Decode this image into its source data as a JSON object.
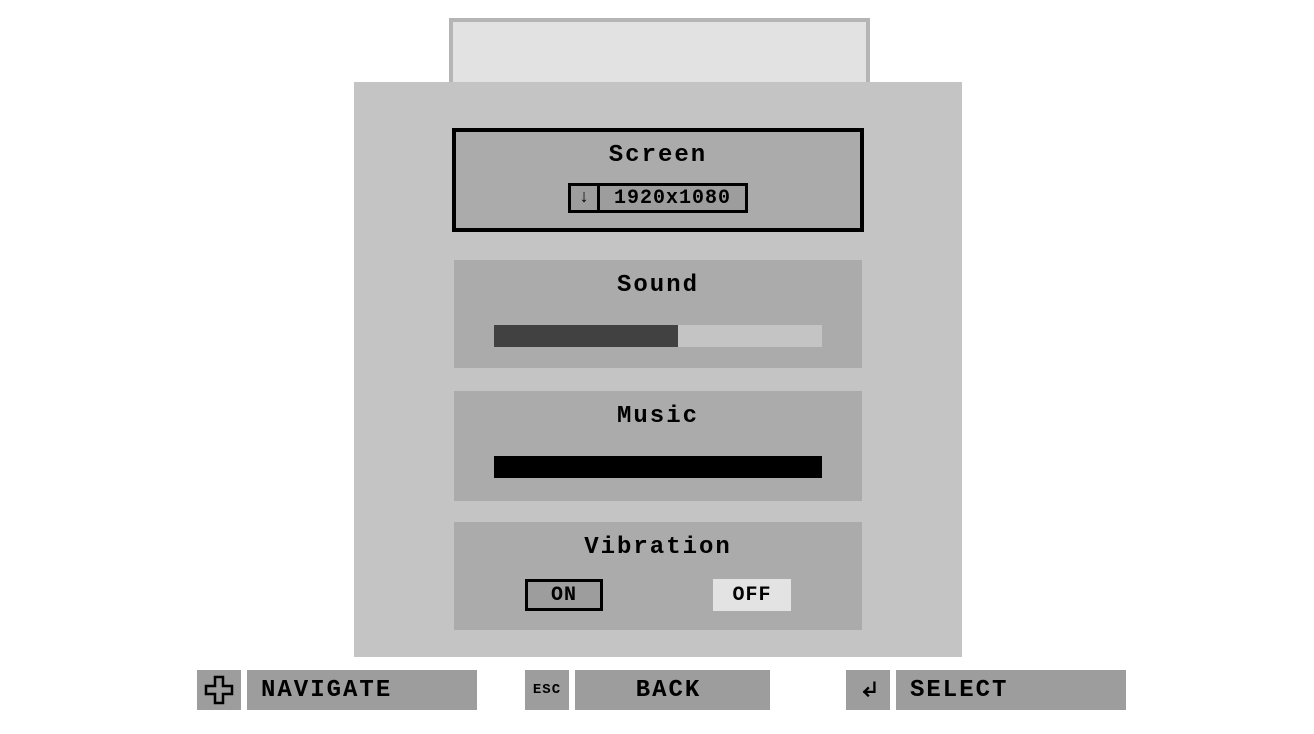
{
  "sections": {
    "screen": {
      "title": "Screen",
      "resolution": "1920x1080",
      "arrow": "↓",
      "selected": true
    },
    "sound": {
      "title": "Sound",
      "level_percent": 56
    },
    "music": {
      "title": "Music",
      "level_percent": 100
    },
    "vibration": {
      "title": "Vibration",
      "on_label": "ON",
      "off_label": "OFF",
      "value": "ON"
    }
  },
  "hints": {
    "navigate": {
      "icon": "dpad",
      "label": "NAVIGATE"
    },
    "back": {
      "icon": "ESC",
      "label": "BACK"
    },
    "select": {
      "icon": "enter",
      "label": "SELECT"
    }
  }
}
